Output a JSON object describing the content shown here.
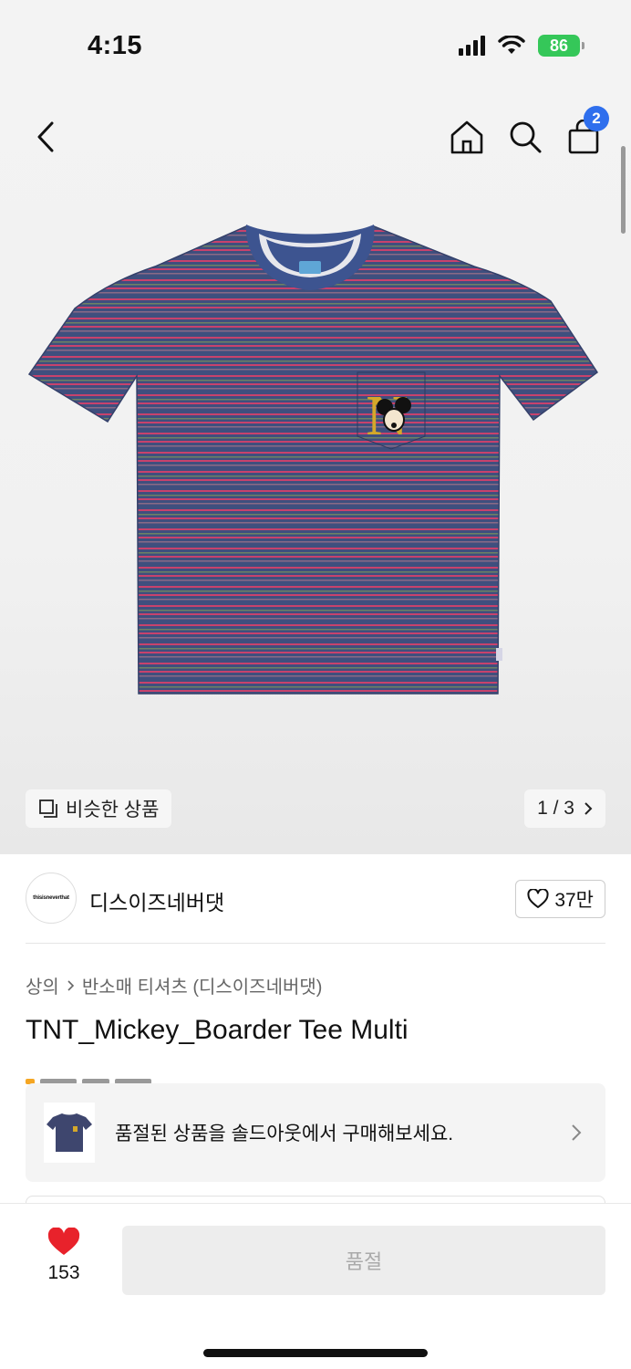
{
  "status_bar": {
    "time": "4:15",
    "battery": "86",
    "icons": [
      "signal-icon",
      "wifi-icon",
      "battery-icon"
    ]
  },
  "nav": {
    "icons": [
      "back-icon",
      "home-icon",
      "search-icon",
      "cart-icon"
    ],
    "cart_count": "2"
  },
  "gallery": {
    "similar_label": "비슷한 상품",
    "pager": "1 / 3",
    "shirt_colors": {
      "base": "#3f4f7e",
      "stripe_pink": "#c8426c",
      "stripe_green": "#6e8264",
      "collar": "#3d5490"
    }
  },
  "brand": {
    "logo_text": "thisisneverthat",
    "name": "디스이즈네버댓",
    "likes": "37만"
  },
  "product": {
    "breadcrumb": [
      "상의",
      "반소매 티셔츠 (디스이즈네버댓)"
    ],
    "title": "TNT_Mickey_Boarder Tee Multi"
  },
  "soldout_banner": {
    "text": "품절된 상품을 솔드아웃에서 구매해보세요."
  },
  "bottom_bar": {
    "wish_count": "153",
    "wish_color": "#e8222b",
    "buy_label": "품절"
  }
}
